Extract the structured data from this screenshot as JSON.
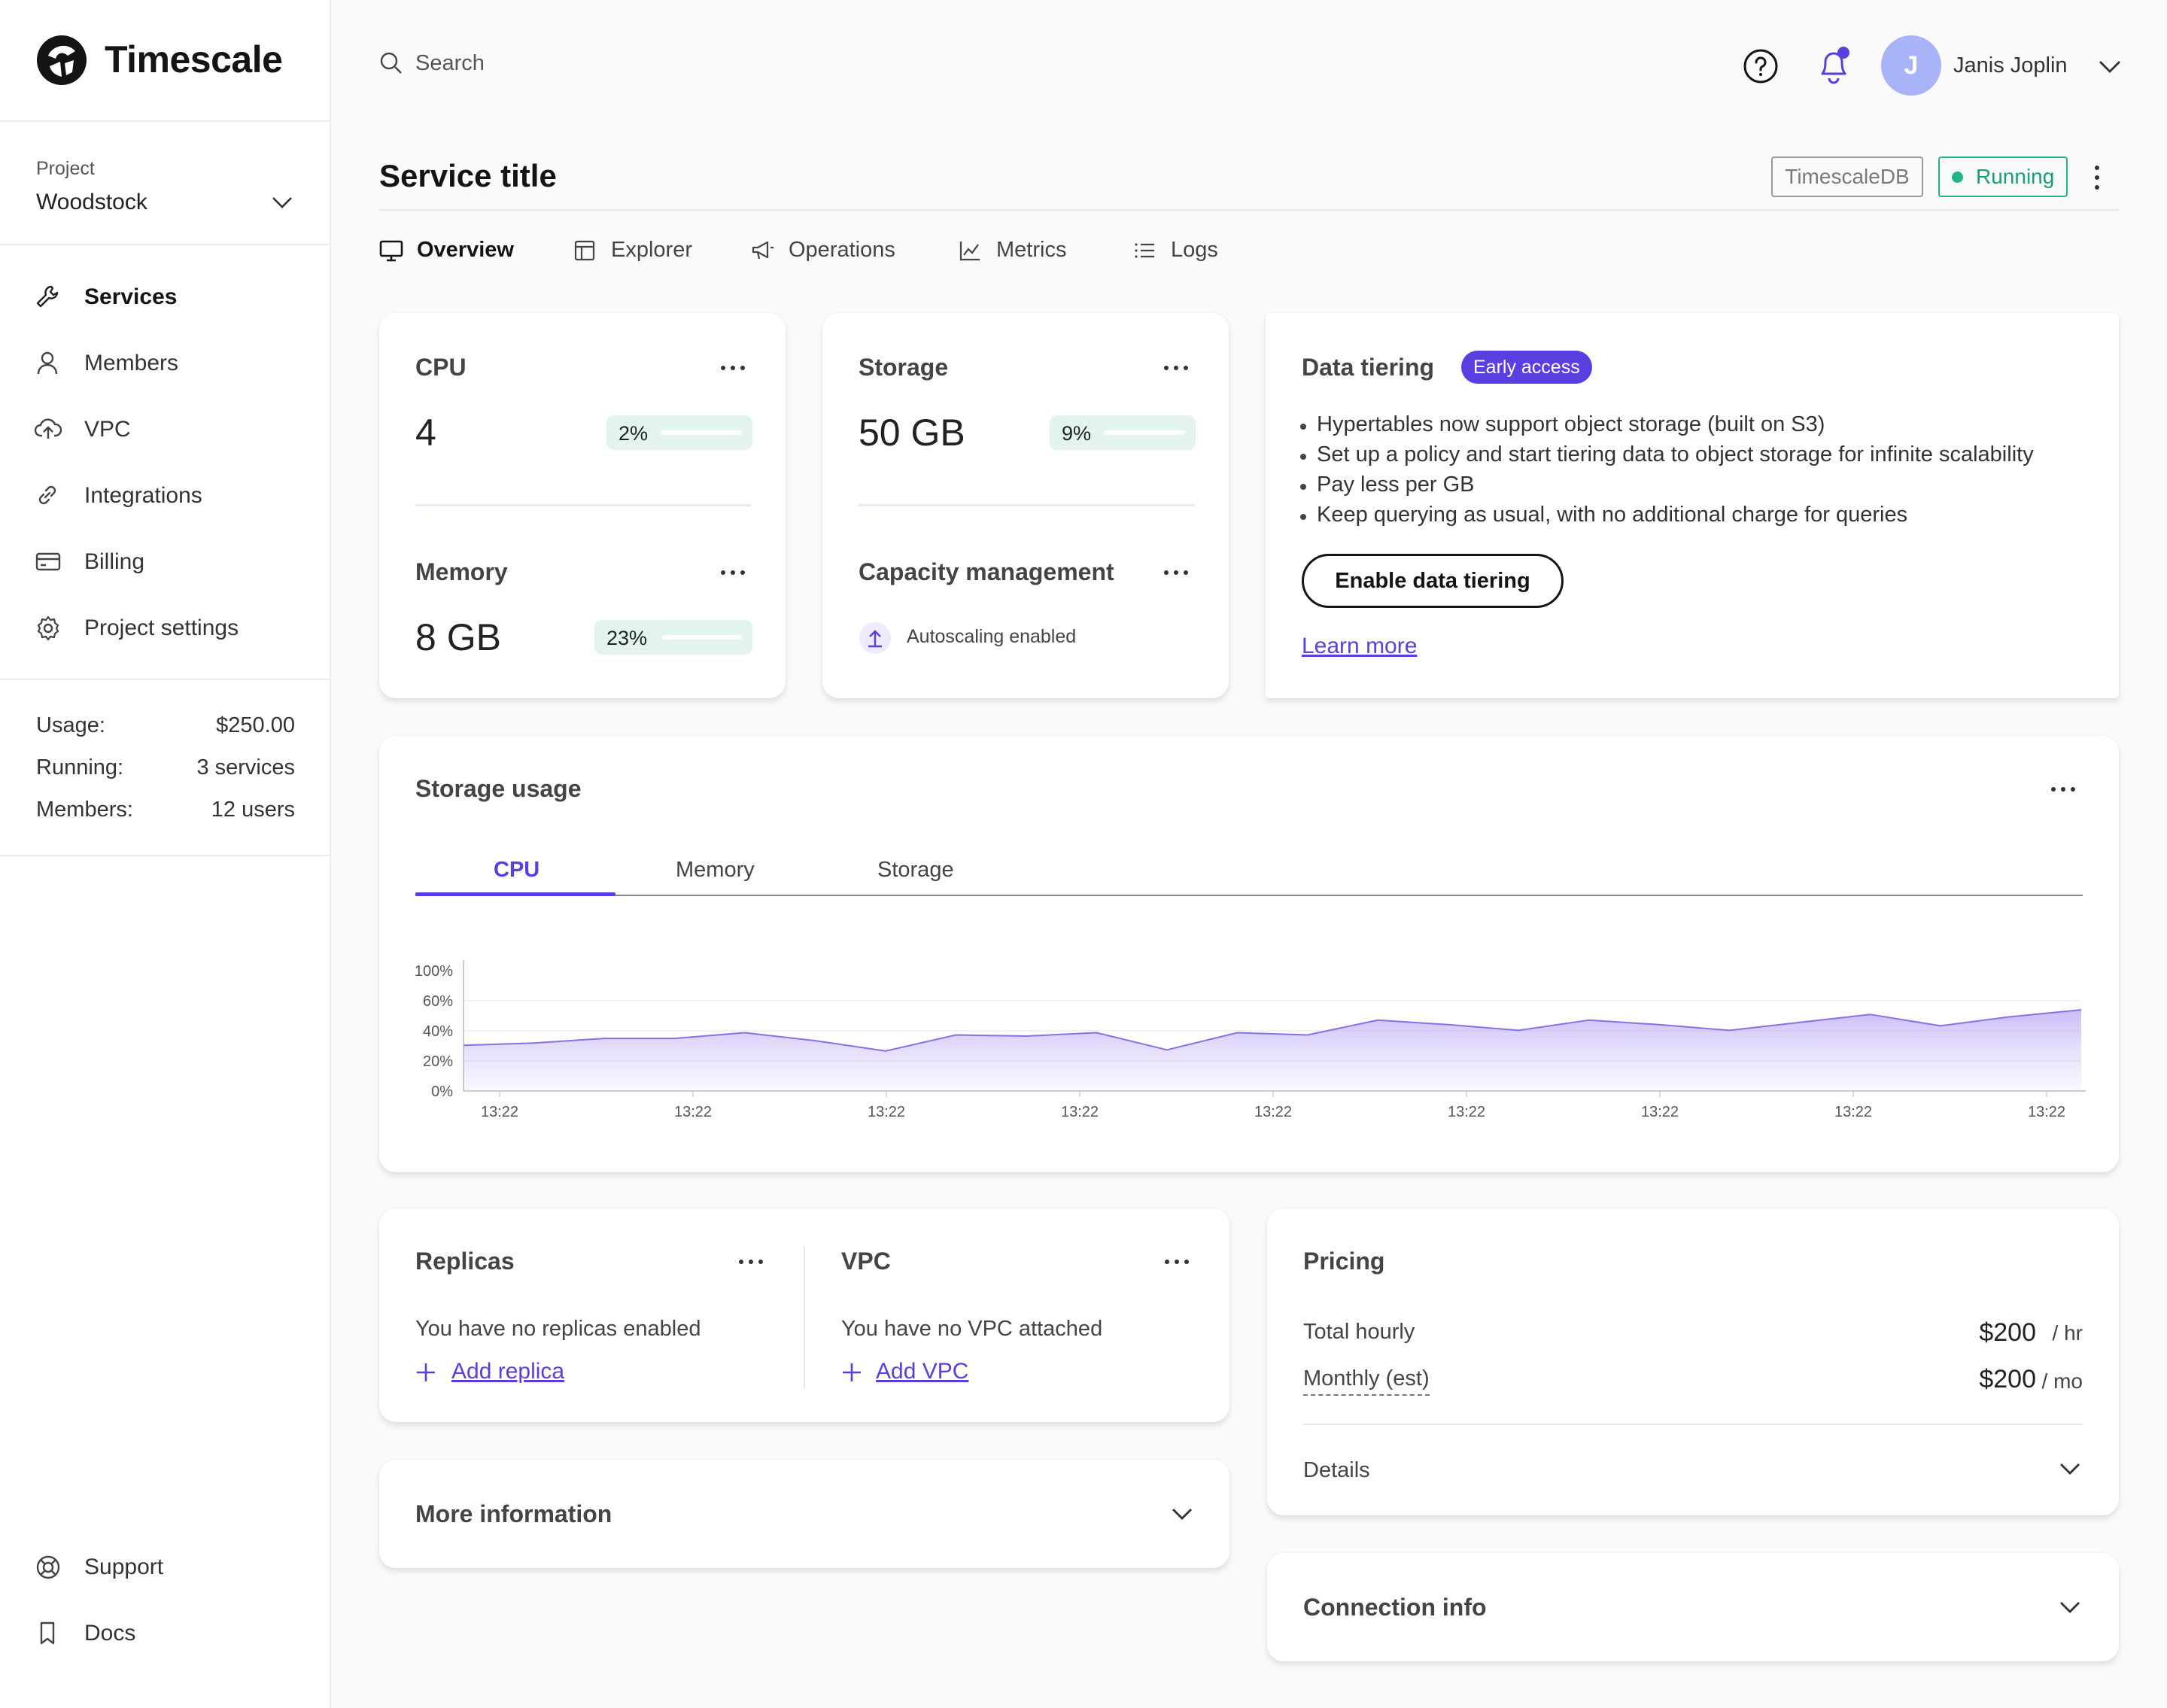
{
  "app": {
    "logo_text": "Timescale"
  },
  "sidebar": {
    "project_label": "Project",
    "project_name": "Woodstock",
    "nav": [
      {
        "label": "Services",
        "icon": "wrench-icon",
        "active": true
      },
      {
        "label": "Members",
        "icon": "user-icon"
      },
      {
        "label": "VPC",
        "icon": "cloud-upload-icon"
      },
      {
        "label": "Integrations",
        "icon": "link-icon"
      },
      {
        "label": "Billing",
        "icon": "credit-card-icon"
      },
      {
        "label": "Project settings",
        "icon": "gear-icon"
      }
    ],
    "stats": [
      {
        "label": "Usage:",
        "value": "$250.00"
      },
      {
        "label": "Running:",
        "value": "3 services"
      },
      {
        "label": "Members:",
        "value": "12 users"
      }
    ],
    "bottom": [
      {
        "label": "Support",
        "icon": "lifebuoy-icon"
      },
      {
        "label": "Docs",
        "icon": "bookmark-icon"
      }
    ]
  },
  "topbar": {
    "search_placeholder": "Search",
    "user_initial": "J",
    "user_name": "Janis Joplin"
  },
  "service": {
    "title": "Service title",
    "db_tag": "TimescaleDB",
    "status": "Running",
    "status_color": "#20b486",
    "tabs": [
      {
        "label": "Overview",
        "icon": "monitor-icon",
        "active": true
      },
      {
        "label": "Explorer",
        "icon": "table-icon"
      },
      {
        "label": "Operations",
        "icon": "megaphone-icon"
      },
      {
        "label": "Metrics",
        "icon": "line-chart-icon"
      },
      {
        "label": "Logs",
        "icon": "list-icon"
      }
    ]
  },
  "cpu_card": {
    "title": "CPU",
    "value": "4",
    "percent": "2%",
    "percent_value": 0.02
  },
  "memory_card": {
    "title": "Memory",
    "value": "8 GB",
    "percent": "23%",
    "percent_value": 0.23
  },
  "storage_card": {
    "title": "Storage",
    "value": "50 GB",
    "percent": "9%",
    "percent_value": 0.09
  },
  "capacity_card": {
    "title": "Capacity management",
    "status": "Autoscaling enabled"
  },
  "tiering": {
    "title": "Data tiering",
    "badge": "Early access",
    "bullets": [
      "Hypertables now support object storage (built on S3)",
      "Set up a policy and start tiering data to object storage for infinite scalability",
      "Pay less per GB",
      "Keep querying as usual, with no additional charge for queries"
    ],
    "button": "Enable data tiering",
    "link": "Learn more"
  },
  "usage_chart": {
    "title": "Storage usage",
    "tabs": [
      "CPU",
      "Memory",
      "Storage"
    ],
    "active_tab": "CPU",
    "accent": "#5b3ee0"
  },
  "chart_data": {
    "type": "area",
    "title": "Storage usage",
    "xlabel": "",
    "ylabel": "",
    "y_ticks": [
      "100%",
      "60%",
      "40%",
      "20%",
      "0%"
    ],
    "x_ticks": [
      "13:22",
      "13:22",
      "13:22",
      "13:22",
      "13:22",
      "13:22",
      "13:22",
      "13:22",
      "13:22"
    ],
    "ylim": [
      0,
      100
    ],
    "series": [
      {
        "values": [
          40,
          42,
          46,
          46,
          51,
          44,
          35,
          49,
          48,
          51,
          36,
          51,
          49,
          62,
          58,
          53,
          62,
          58,
          53,
          60,
          67,
          57,
          65,
          71
        ]
      }
    ],
    "grid": true
  },
  "replicas": {
    "title": "Replicas",
    "text": "You have no replicas enabled",
    "action": "Add replica"
  },
  "vpc": {
    "title": "VPC",
    "text": "You have no VPC attached",
    "action": "Add VPC"
  },
  "pricing": {
    "title": "Pricing",
    "rows": [
      {
        "label": "Total hourly",
        "value": "$200",
        "unit": "/ hr"
      },
      {
        "label": "Monthly (est)",
        "value": "$200",
        "unit": "/ mo"
      }
    ],
    "details": "Details"
  },
  "more_info": {
    "title": "More information"
  },
  "connection_info": {
    "title": "Connection info"
  }
}
